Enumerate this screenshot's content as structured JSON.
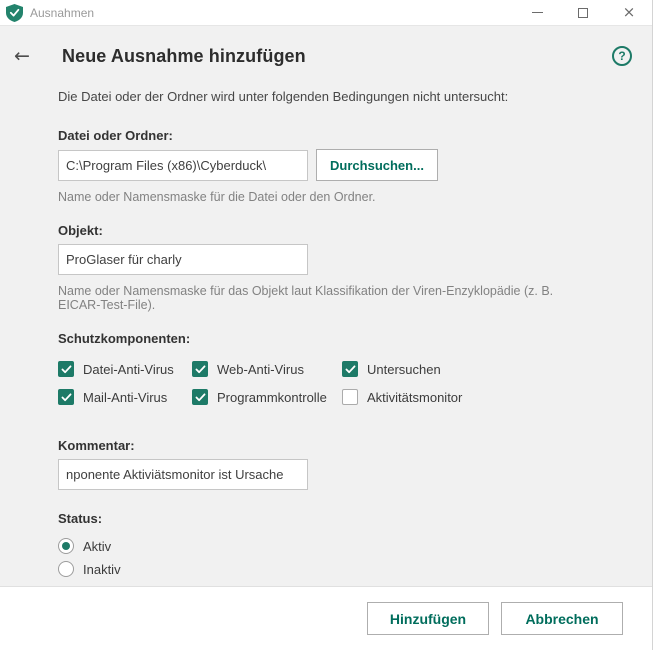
{
  "window": {
    "title": "Ausnahmen"
  },
  "header": {
    "title": "Neue Ausnahme hinzufügen"
  },
  "intro": "Die Datei oder der Ordner wird unter folgenden Bedingungen nicht untersucht:",
  "file_section": {
    "label": "Datei oder Ordner:",
    "value": "C:\\Program Files (x86)\\Cyberduck\\",
    "browse_label": "Durchsuchen...",
    "hint": "Name oder Namensmaske für die Datei oder den Ordner."
  },
  "object_section": {
    "label": "Objekt:",
    "value": "ProGlaser für charly",
    "hint": "Name oder Namensmaske für das Objekt laut Klassifikation der Viren-Enzyklopädie (z. B. EICAR-Test-File)."
  },
  "components_section": {
    "label": "Schutzkomponenten:",
    "items": [
      {
        "label": "Datei-Anti-Virus",
        "checked": true
      },
      {
        "label": "Web-Anti-Virus",
        "checked": true
      },
      {
        "label": "Untersuchen",
        "checked": true
      },
      {
        "label": "Mail-Anti-Virus",
        "checked": true
      },
      {
        "label": "Programmkontrolle",
        "checked": true
      },
      {
        "label": "Aktivitätsmonitor",
        "checked": false
      }
    ]
  },
  "comment_section": {
    "label": "Kommentar:",
    "value": "nponente Aktiviätsmonitor ist Ursache"
  },
  "status_section": {
    "label": "Status:",
    "options": [
      {
        "label": "Aktiv",
        "selected": true
      },
      {
        "label": "Inaktiv",
        "selected": false
      }
    ]
  },
  "footer": {
    "add_label": "Hinzufügen",
    "cancel_label": "Abbrechen"
  },
  "icons": {
    "app_icon": "kaspersky-shield",
    "back": "←",
    "help": "?",
    "close": "×"
  },
  "colors": {
    "accent_green": "#1d7a67",
    "button_text_green": "#006d5c",
    "content_background": "#f1f1f1"
  }
}
